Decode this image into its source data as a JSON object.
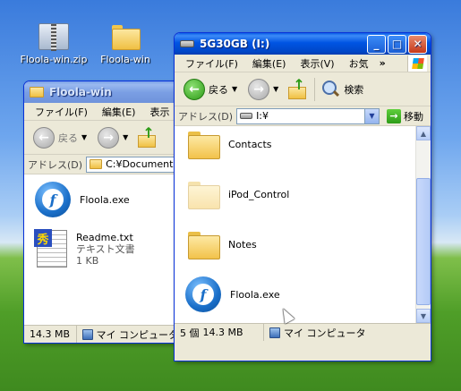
{
  "desktop": {
    "icons": [
      {
        "label": "Floola-win.zip",
        "icon": "zip-archive-icon"
      },
      {
        "label": "Floola-win",
        "icon": "folder-icon"
      }
    ]
  },
  "back_window": {
    "title": "Floola-win",
    "menu": [
      "ファイル(F)",
      "編集(E)",
      "表示"
    ],
    "toolbar": {
      "back_label": "戻る"
    },
    "address": {
      "label": "アドレス(D)",
      "value": "C:¥Documents"
    },
    "files": [
      {
        "name": "Floola.exe",
        "icon": "floola-app-icon"
      },
      {
        "name": "Readme.txt",
        "type": "テキスト文書",
        "size": "1 KB",
        "icon": "text-file-icon"
      }
    ],
    "status": {
      "size": "14.3 MB",
      "location": "マイ コンピュータ"
    }
  },
  "front_window": {
    "title": "5G30GB (I:)",
    "menu": [
      "ファイル(F)",
      "編集(E)",
      "表示(V)",
      "お気"
    ],
    "menu_overflow": "»",
    "toolbar": {
      "back_label": "戻る",
      "search_label": "検索"
    },
    "address": {
      "label": "アドレス(D)",
      "value": "I:¥",
      "go_label": "移動"
    },
    "files": [
      {
        "name": "Contacts",
        "icon": "folder-icon"
      },
      {
        "name": "iPod_Control",
        "icon": "folder-icon",
        "hidden": true
      },
      {
        "name": "Notes",
        "icon": "folder-icon"
      },
      {
        "name": "Floola.exe",
        "icon": "floola-app-icon"
      }
    ],
    "status": {
      "count": "5 個",
      "size": "14.3 MB",
      "location": "マイ コンピュータ"
    }
  }
}
